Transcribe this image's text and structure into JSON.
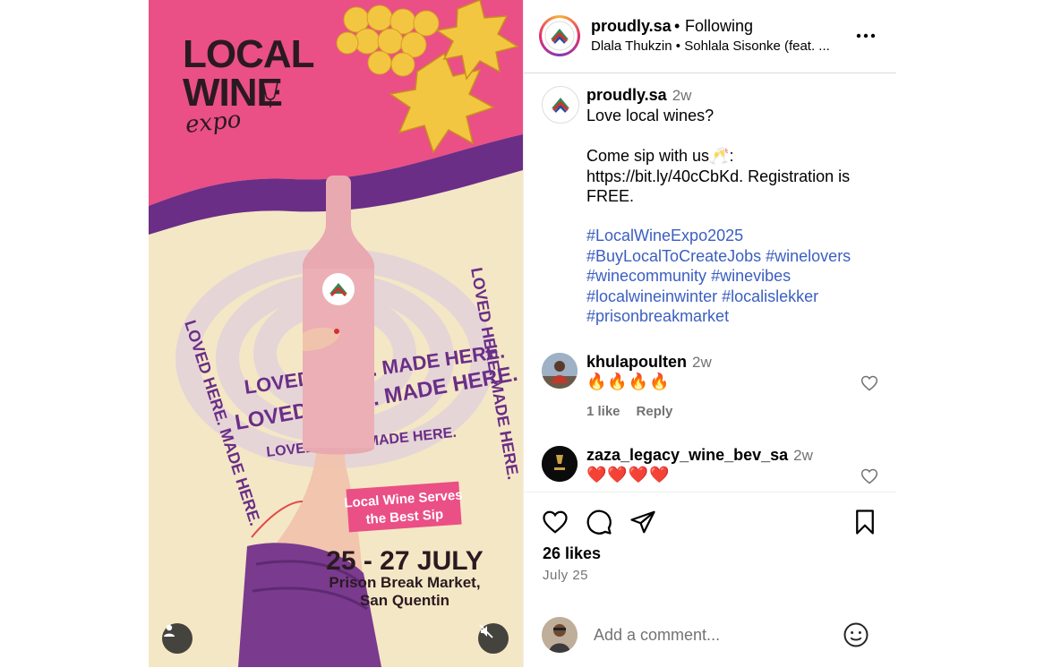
{
  "header": {
    "username": "proudly.sa",
    "separator": "•",
    "follow_status": "Following",
    "audio_artist": "Dlala Thukzin",
    "audio_separator": "•",
    "audio_track": "Sohlala Sisonke (feat. ..."
  },
  "media": {
    "poster_title_1": "LOCAL",
    "poster_title_2": "WINE",
    "poster_script": "expo",
    "tagline_1": "Local Wine Serves",
    "tagline_2": "the Best Sip",
    "dates": "25 - 27 JULY",
    "venue_1": "Prison Break Market,",
    "venue_2": "San Quentin",
    "spiral_text": "LOVED HERE. MADE HERE.",
    "icons": {
      "user": "user-tag-icon",
      "mute": "muted-speaker-icon"
    }
  },
  "caption": {
    "username": "proudly.sa",
    "time": "2w",
    "line1": "Love local wines?",
    "line2": "Come sip with us🥂:",
    "line3": "https://bit.ly/40cCbKd. Registration is",
    "line4": "FREE.",
    "hashtags": [
      "#LocalWineExpo2025",
      "#BuyLocalToCreateJobs",
      "#winelovers",
      "#winecommunity",
      "#winevibes",
      "#localwineinwinter",
      "#localislekker",
      "#prisonbreakmarket"
    ]
  },
  "comments": [
    {
      "username": "khulapoulten",
      "time": "2w",
      "text": "🔥🔥🔥🔥",
      "likes": "1 like",
      "reply": "Reply"
    },
    {
      "username": "zaza_legacy_wine_bev_sa",
      "time": "2w",
      "text": "❤️❤️❤️❤️"
    }
  ],
  "actions": {
    "likes": "26 likes",
    "date": "July 25",
    "comment_placeholder": "Add a comment...",
    "icons": [
      "heart-icon",
      "comment-icon",
      "share-icon",
      "bookmark-icon",
      "emoji-icon",
      "more-icon"
    ]
  },
  "colors": {
    "poster_pink": "#ea4f86",
    "poster_purple": "#6a2e87",
    "poster_cream": "#f4e7c5",
    "bottle_pink": "#e9a9b0",
    "grape_yellow": "#f3c642",
    "link_blue": "#3b5fc0",
    "muted_gray": "#737373"
  }
}
